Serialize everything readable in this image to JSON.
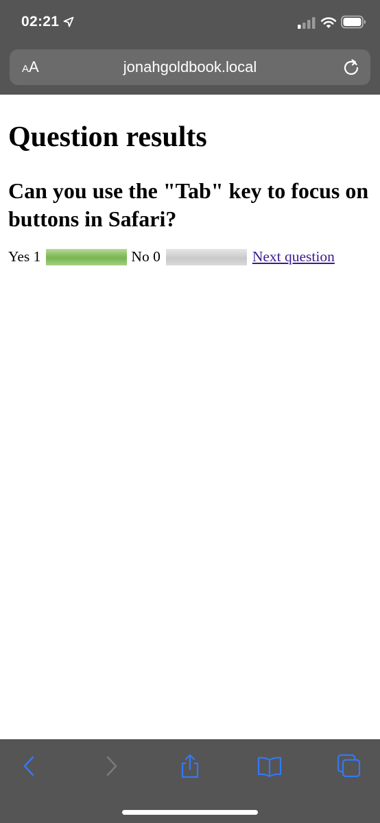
{
  "status_bar": {
    "time": "02:21"
  },
  "browser": {
    "aa_label_small": "A",
    "aa_label_large": "A",
    "url": "jonahgoldbook.local"
  },
  "page": {
    "title": "Question results",
    "question": "Can you use the \"Tab\" key to focus on buttons in Safari?",
    "results": [
      {
        "label": "Yes 1",
        "fraction": 1.0
      },
      {
        "label": "No 0",
        "fraction": 0.0
      }
    ],
    "next_link": "Next question"
  },
  "toolbar": {
    "icons": [
      "back-icon",
      "forward-icon",
      "share-icon",
      "bookmarks-icon",
      "tabs-icon"
    ]
  },
  "colors": {
    "chrome": "#555555",
    "accent": "#3478f6",
    "yes_bar": "#79b550",
    "no_bar": "#d2d2d2"
  }
}
